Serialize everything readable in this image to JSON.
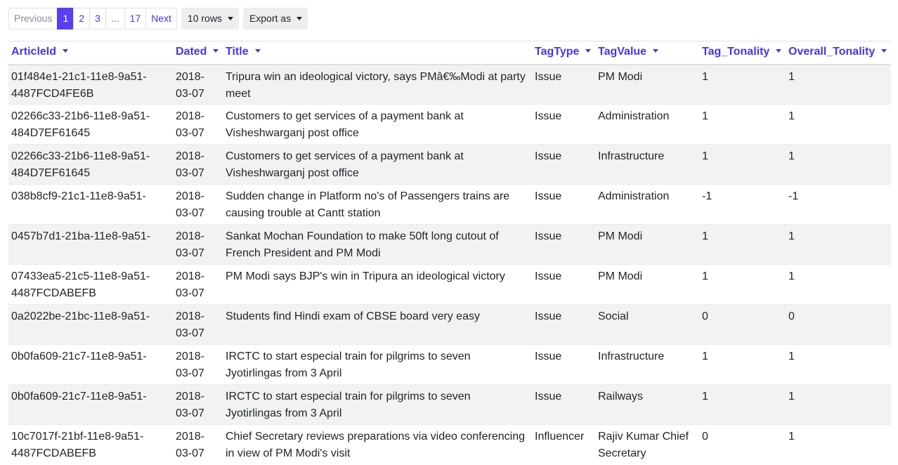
{
  "pagination": {
    "previous": "Previous",
    "pages": [
      "1",
      "2",
      "3"
    ],
    "ellipsis": "...",
    "last_page": "17",
    "next": "Next",
    "active_page": "1"
  },
  "rows_select": {
    "label": "10 rows"
  },
  "export": {
    "label": "Export as"
  },
  "table": {
    "columns": [
      "ArticleId",
      "Dated",
      "Title",
      "TagType",
      "TagValue",
      "Tag_Tonality",
      "Overall_Tonality"
    ],
    "rows": [
      {
        "article_id": "01f484e1-21c1-11e8-9a51-4487FCD4FE6B",
        "dated": "2018-03-07",
        "title": "Tripura win an ideological victory, says PMâ€‰Modi at party meet",
        "tag_type": "Issue",
        "tag_value": "PM Modi",
        "tag_tonality": "1",
        "overall_tonality": "1"
      },
      {
        "article_id": "02266c33-21b6-11e8-9a51-484D7EF61645",
        "dated": "2018-03-07",
        "title": "Customers to get services of a payment bank at Visheshwarganj post office",
        "tag_type": "Issue",
        "tag_value": "Administration",
        "tag_tonality": "1",
        "overall_tonality": "1"
      },
      {
        "article_id": "02266c33-21b6-11e8-9a51-484D7EF61645",
        "dated": "2018-03-07",
        "title": "Customers to get services of a payment bank at Visheshwarganj post office",
        "tag_type": "Issue",
        "tag_value": "Infrastructure",
        "tag_tonality": "1",
        "overall_tonality": "1"
      },
      {
        "article_id": "038b8cf9-21c1-11e8-9a51-",
        "dated": "2018-03-07",
        "title": "Sudden change in Platform no's of Passengers trains are causing trouble at Cantt station",
        "tag_type": "Issue",
        "tag_value": "Administration",
        "tag_tonality": "-1",
        "overall_tonality": "-1"
      },
      {
        "article_id": "0457b7d1-21ba-11e8-9a51-",
        "dated": "2018-03-07",
        "title": "Sankat Mochan Foundation to make 50ft long cutout of French President and PM Modi",
        "tag_type": "Issue",
        "tag_value": "PM Modi",
        "tag_tonality": "1",
        "overall_tonality": "1"
      },
      {
        "article_id": "07433ea5-21c5-11e8-9a51-4487FCDABEFB",
        "dated": "2018-03-07",
        "title": "PM Modi says BJP's win in Tripura an ideological victory",
        "tag_type": "Issue",
        "tag_value": "PM Modi",
        "tag_tonality": "1",
        "overall_tonality": "1"
      },
      {
        "article_id": "0a2022be-21bc-11e8-9a51-",
        "dated": "2018-03-07",
        "title": "Students find Hindi exam of CBSE board very easy",
        "tag_type": "Issue",
        "tag_value": "Social",
        "tag_tonality": "0",
        "overall_tonality": "0"
      },
      {
        "article_id": "0b0fa609-21c7-11e8-9a51-",
        "dated": "2018-03-07",
        "title": "IRCTC to start especial train for pilgrims to seven Jyotirlingas from 3 April",
        "tag_type": "Issue",
        "tag_value": "Infrastructure",
        "tag_tonality": "1",
        "overall_tonality": "1"
      },
      {
        "article_id": "0b0fa609-21c7-11e8-9a51-",
        "dated": "2018-03-07",
        "title": "IRCTC to start especial train for pilgrims to seven Jyotirlingas from 3 April",
        "tag_type": "Issue",
        "tag_value": "Railways",
        "tag_tonality": "1",
        "overall_tonality": "1"
      },
      {
        "article_id": "10c7017f-21bf-11e8-9a51-4487FCDABEFB",
        "dated": "2018-03-07",
        "title": "Chief Secretary reviews preparations via video conferencing in view of PM Modi's visit",
        "tag_type": "Influencer",
        "tag_value": "Rajiv Kumar Chief Secretary",
        "tag_tonality": "0",
        "overall_tonality": "1"
      }
    ]
  },
  "colors": {
    "accent": "#4a34e8",
    "active_page_bg": "#5a3ff2",
    "stripe": "#f2f2f2"
  }
}
